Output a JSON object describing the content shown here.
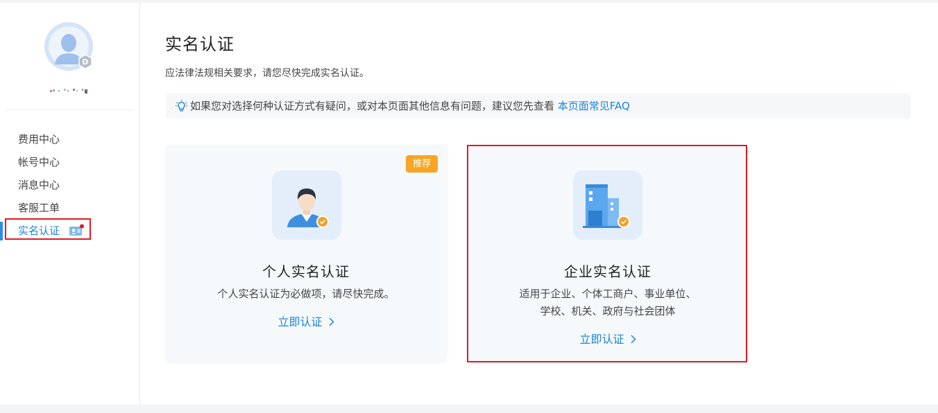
{
  "sidebar": {
    "username": "",
    "menu": [
      {
        "label": "费用中心"
      },
      {
        "label": "帐号中心"
      },
      {
        "label": "消息中心"
      },
      {
        "label": "客服工单"
      },
      {
        "label": "实名认证",
        "active": true
      }
    ]
  },
  "main": {
    "title": "实名认证",
    "subtitle": "应法律法规相关要求，请您尽快完成实名认证。",
    "tip": {
      "text": "如果您对选择何种认证方式有疑问，或对本页面其他信息有问题，建议您先查看 ",
      "link": "本页面常见FAQ",
      "icon": "lightbulb-icon"
    },
    "cards": {
      "personal": {
        "badge": "推荐",
        "title": "个人实名认证",
        "desc": "个人实名认证为必做项，请尽快完成。",
        "action": "立即认证",
        "icon": "person-verified-icon"
      },
      "enterprise": {
        "title": "企业实名认证",
        "desc_line1": "适用于企业、个体工商户、事业单位、",
        "desc_line2": "学校、机关、政府与社会团体",
        "action": "立即认证",
        "icon": "building-verified-icon"
      }
    }
  },
  "colors": {
    "accent": "#1c84d8",
    "badge": "#f8a623",
    "highlight_border": "#e0191f",
    "active_bar": "#2d8cf0"
  }
}
